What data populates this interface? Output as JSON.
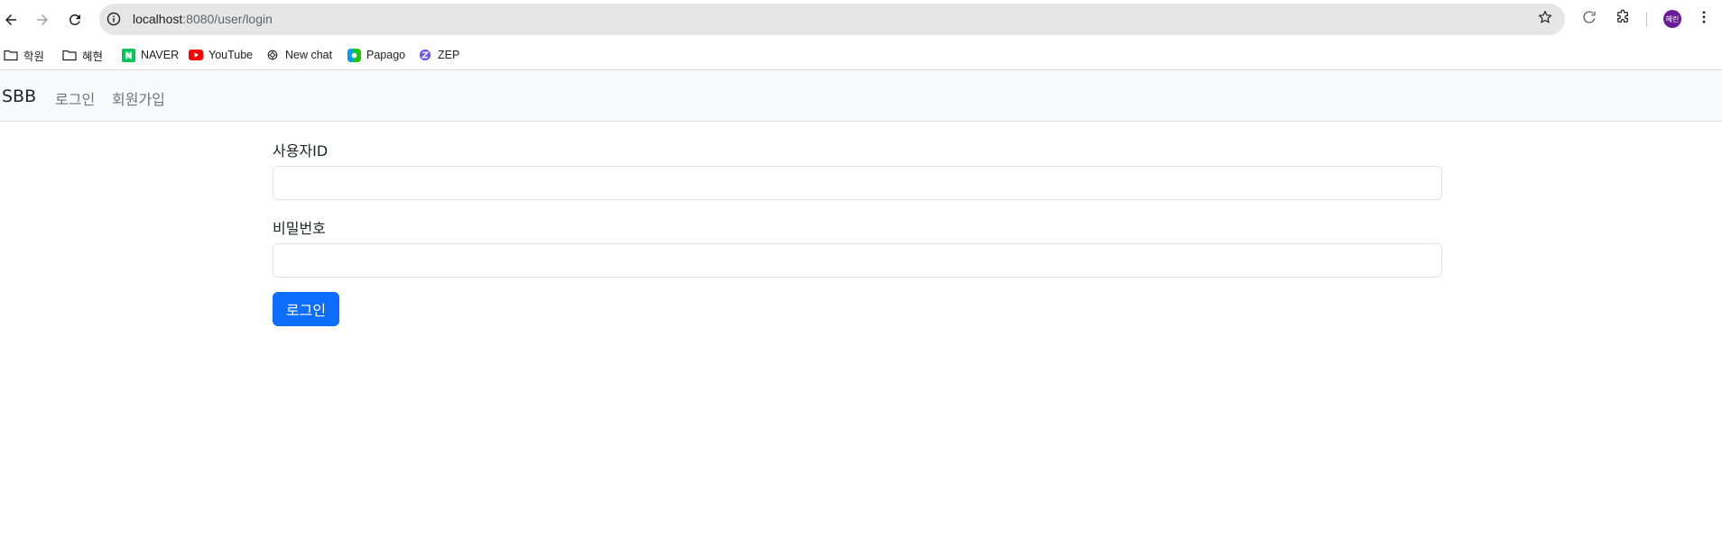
{
  "browser": {
    "url_host": "localhost",
    "url_path": ":8080/user/login",
    "avatar_text": "혜린",
    "avatar_color": "#6a1b9a",
    "icons": [
      "back-arrow-icon",
      "forward-arrow-icon",
      "reload-icon",
      "site-info-icon",
      "star-icon",
      "refresh-extension-icon",
      "puzzle-extension-icon",
      "kebab-menu-icon"
    ]
  },
  "bookmarks": [
    {
      "label": "학원",
      "icon": "folder-icon"
    },
    {
      "label": "혜현",
      "icon": "folder-icon"
    },
    {
      "label": "NAVER",
      "icon": "naver-icon"
    },
    {
      "label": "YouTube",
      "icon": "youtube-icon"
    },
    {
      "label": "New chat",
      "icon": "chatgpt-icon"
    },
    {
      "label": "Papago",
      "icon": "papago-icon"
    },
    {
      "label": "ZEP",
      "icon": "zep-icon"
    }
  ],
  "navbar": {
    "brand": "SBB",
    "links": [
      "로그인",
      "회원가입"
    ]
  },
  "form": {
    "username_label": "사용자ID",
    "password_label": "비밀번호",
    "submit_label": "로그인"
  },
  "colors": {
    "primary": "#0d6efd",
    "navbar_bg": "#f8f9fa"
  }
}
